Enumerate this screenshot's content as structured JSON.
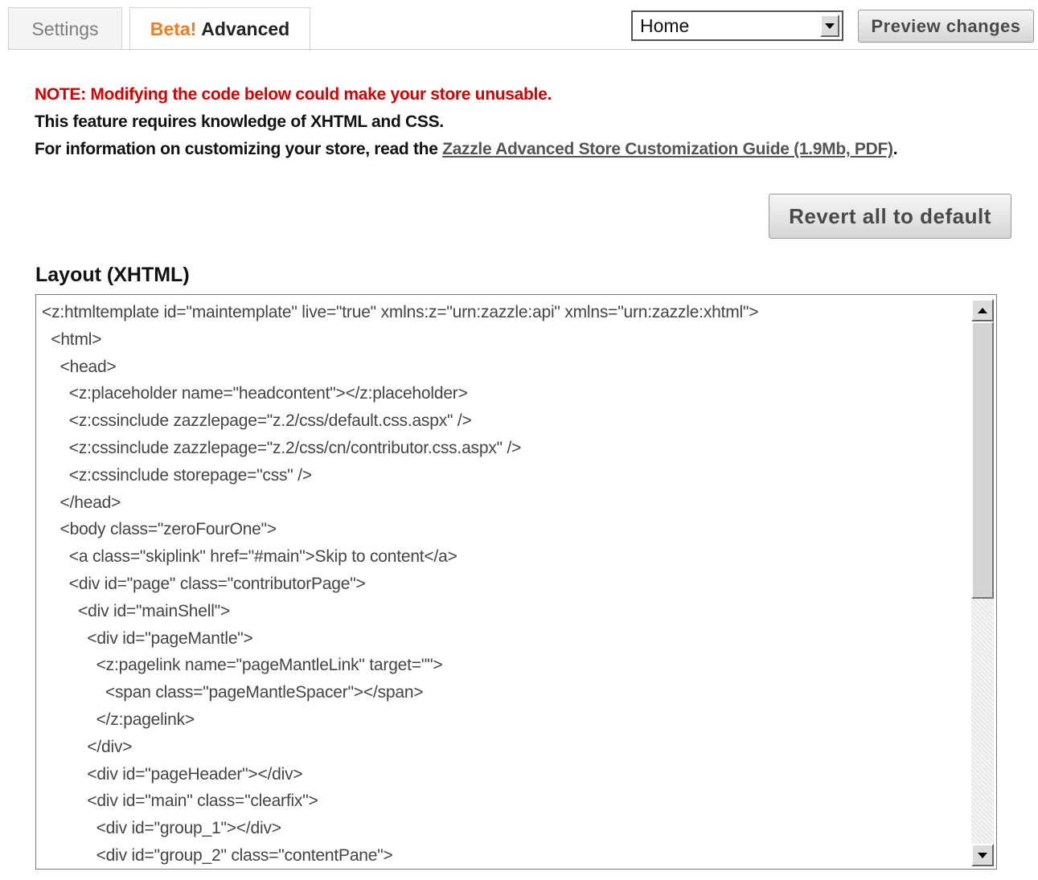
{
  "tabs": [
    {
      "label": "Settings",
      "active": false
    },
    {
      "beta": "Beta!",
      "label": "Advanced",
      "active": true
    }
  ],
  "page_select": {
    "value": "Home"
  },
  "preview_button": {
    "label": "Preview changes"
  },
  "notes": {
    "warning": "NOTE: Modifying the code below could make your store unusable.",
    "requirement": "This feature requires knowledge of XHTML and CSS.",
    "info_prefix": "For information on customizing your store, read the ",
    "guide_link": "Zazzle Advanced Store Customization Guide (1.9Mb, PDF)",
    "info_suffix": "."
  },
  "revert_button": {
    "label": "Revert all to default"
  },
  "layout": {
    "heading": "Layout (XHTML)",
    "code_lines": [
      "<z:htmltemplate id=\"maintemplate\" live=\"true\" xmlns:z=\"urn:zazzle:api\" xmlns=\"urn:zazzle:xhtml\">",
      "  <html>",
      "    <head>",
      "      <z:placeholder name=\"headcontent\"></z:placeholder>",
      "      <z:cssinclude zazzlepage=\"z.2/css/default.css.aspx\" />",
      "      <z:cssinclude zazzlepage=\"z.2/css/cn/contributor.css.aspx\" />",
      "      <z:cssinclude storepage=\"css\" />",
      "    </head>",
      "    <body class=\"zeroFourOne\">",
      "      <a class=\"skiplink\" href=\"#main\">Skip to content</a>",
      "      <div id=\"page\" class=\"contributorPage\">",
      "        <div id=\"mainShell\">",
      "          <div id=\"pageMantle\">",
      "            <z:pagelink name=\"pageMantleLink\" target=\"\">",
      "              <span class=\"pageMantleSpacer\"></span>",
      "            </z:pagelink>",
      "          </div>",
      "          <div id=\"pageHeader\"></div>",
      "          <div id=\"main\" class=\"clearfix\">",
      "            <div id=\"group_1\"></div>",
      "            <div id=\"group_2\" class=\"contentPane\">"
    ]
  }
}
